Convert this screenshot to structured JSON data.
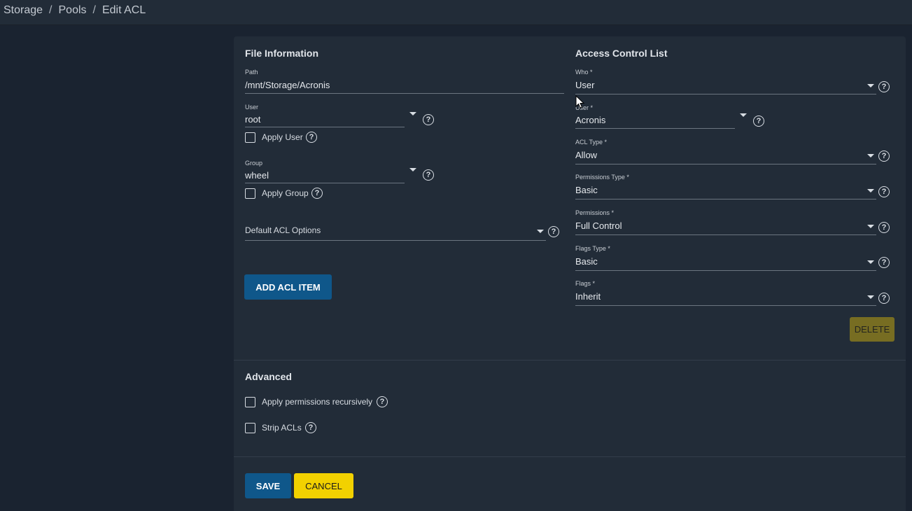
{
  "breadcrumb": [
    "Storage",
    "Pools",
    "Edit ACL"
  ],
  "breadcrumb_sep": "/",
  "file_info": {
    "title": "File Information",
    "path_label": "Path",
    "path_value": "/mnt/Storage/Acronis",
    "user_label": "User",
    "user_value": "root",
    "apply_user": "Apply User",
    "group_label": "Group",
    "group_value": "wheel",
    "apply_group": "Apply Group",
    "default_acl": "Default ACL Options",
    "add_acl_item": "ADD ACL ITEM"
  },
  "acl": {
    "title": "Access Control List",
    "who_label": "Who *",
    "who_value": "User",
    "user_label": "User *",
    "user_value": "Acronis",
    "acl_type_label": "ACL Type *",
    "acl_type_value": "Allow",
    "perm_type_label": "Permissions Type *",
    "perm_type_value": "Basic",
    "perms_label": "Permissions *",
    "perms_value": "Full Control",
    "flags_type_label": "Flags Type *",
    "flags_type_value": "Basic",
    "flags_label": "Flags *",
    "flags_value": "Inherit",
    "delete": "DELETE"
  },
  "advanced": {
    "title": "Advanced",
    "recursive": "Apply permissions recursively",
    "strip": "Strip ACLs"
  },
  "actions": {
    "save": "SAVE",
    "cancel": "CANCEL"
  },
  "help_glyph": "?",
  "colors": {
    "primary": "#0f578a",
    "accent": "#f2d100",
    "background": "#1a2330",
    "card": "#222c38"
  }
}
